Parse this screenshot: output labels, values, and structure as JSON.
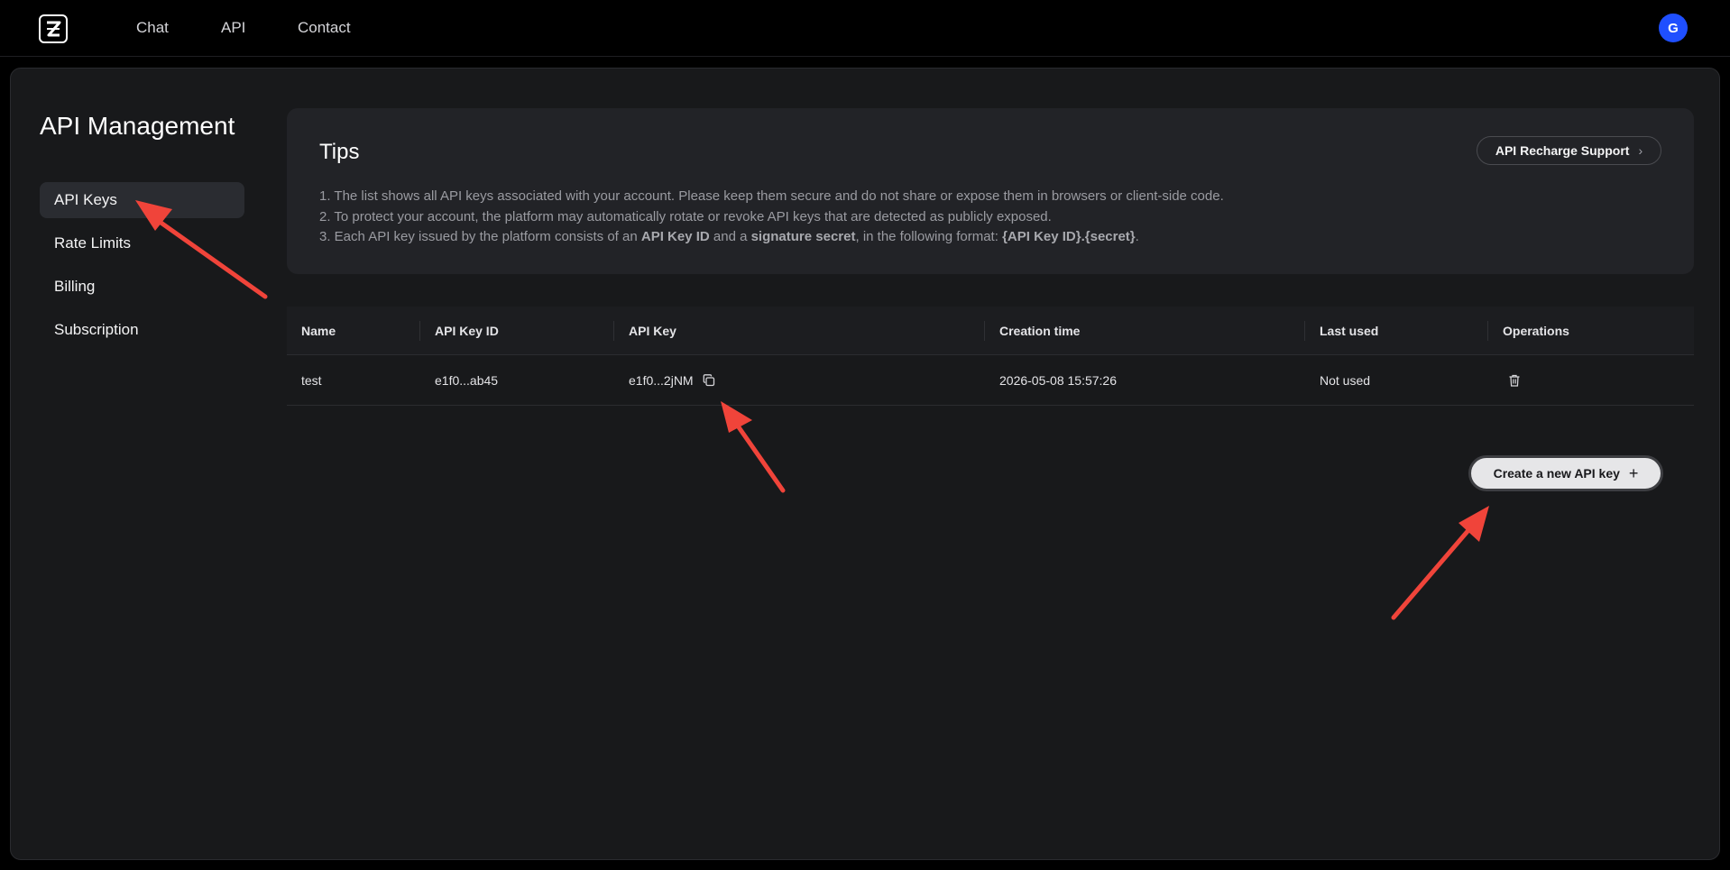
{
  "nav": {
    "links": [
      "Chat",
      "API",
      "Contact"
    ],
    "avatar_initial": "G"
  },
  "page": {
    "title": "API Management"
  },
  "sidebar": {
    "items": [
      {
        "label": "API Keys",
        "active": true
      },
      {
        "label": "Rate Limits",
        "active": false
      },
      {
        "label": "Billing",
        "active": false
      },
      {
        "label": "Subscription",
        "active": false
      }
    ]
  },
  "tips": {
    "title": "Tips",
    "recharge_label": "API Recharge Support",
    "line1": "1. The list shows all API keys associated with your account. Please keep them secure and do not share or expose them in browsers or client-side code.",
    "line2": "2. To protect your account, the platform may automatically rotate or revoke API keys that are detected as publicly exposed.",
    "line3_a": "3. Each API key issued by the platform consists of an ",
    "line3_b": "API Key ID",
    "line3_c": " and a ",
    "line3_d": "signature secret",
    "line3_e": ", in the following format: ",
    "line3_f": "{API Key ID}.{secret}",
    "line3_g": "."
  },
  "table": {
    "headers": [
      "Name",
      "API Key ID",
      "API Key",
      "Creation time",
      "Last used",
      "Operations"
    ],
    "rows": [
      {
        "name": "test",
        "key_id": "e1f0...ab45",
        "api_key": "e1f0...2jNM",
        "created": "2026-05-08 15:57:26",
        "last_used": "Not used"
      }
    ]
  },
  "actions": {
    "create_label": "Create a new API key"
  },
  "colors": {
    "background": "#000000",
    "panel": "#18191b",
    "card": "#222327",
    "avatar": "#1f4fff",
    "annotation_arrow": "#f0443a"
  },
  "icons": [
    "logo-icon",
    "chevron-right-icon",
    "copy-icon",
    "trash-icon",
    "plus-icon"
  ]
}
